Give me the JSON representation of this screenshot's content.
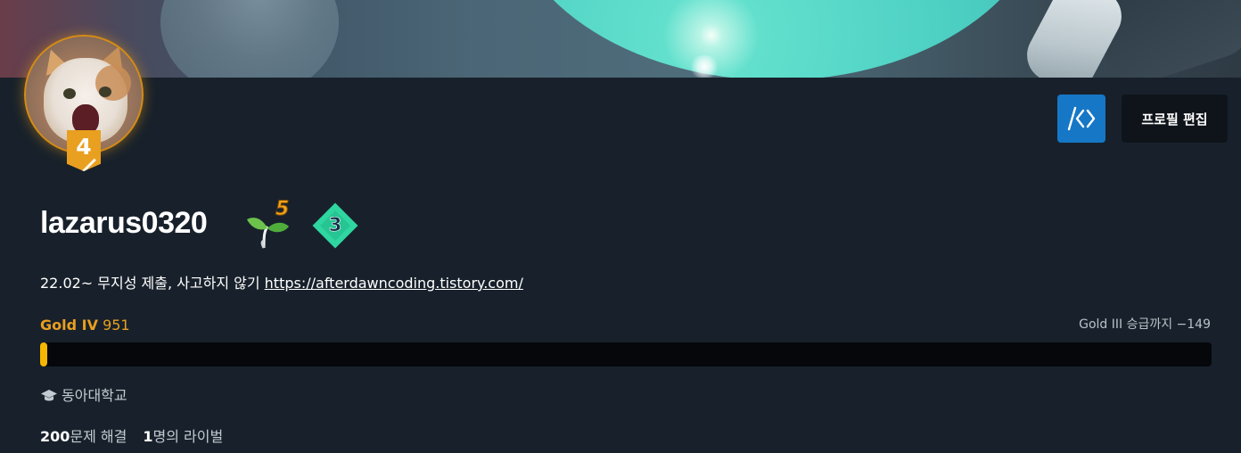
{
  "profile": {
    "tier_level": "4",
    "username": "lazarus0320",
    "class_level": "5",
    "arena_rank": "3",
    "bio_text": "22.02~ 무지성 제출, 사고하지 않기 ",
    "bio_link": "https://afterdawncoding.tistory.com/",
    "school": "동아대학교"
  },
  "buttons": {
    "code_icon": "code-brackets-icon",
    "edit_profile": "프로필 편집"
  },
  "rating": {
    "tier_name": "Gold IV",
    "value": "951",
    "next_text": "Gold III 승급까지 −149",
    "progress_fraction": 0.006
  },
  "stats": {
    "solved_count": "200",
    "solved_label": "문제 해결",
    "rival_count": "1",
    "rival_label": "명의 라이벌"
  },
  "colors": {
    "background": "#18212b",
    "gold": "#e99f1f",
    "bar_fill": "#f5b700",
    "code_button": "#1677c6",
    "edit_button": "#0f141b",
    "arena_green": "#2fd6a0"
  }
}
